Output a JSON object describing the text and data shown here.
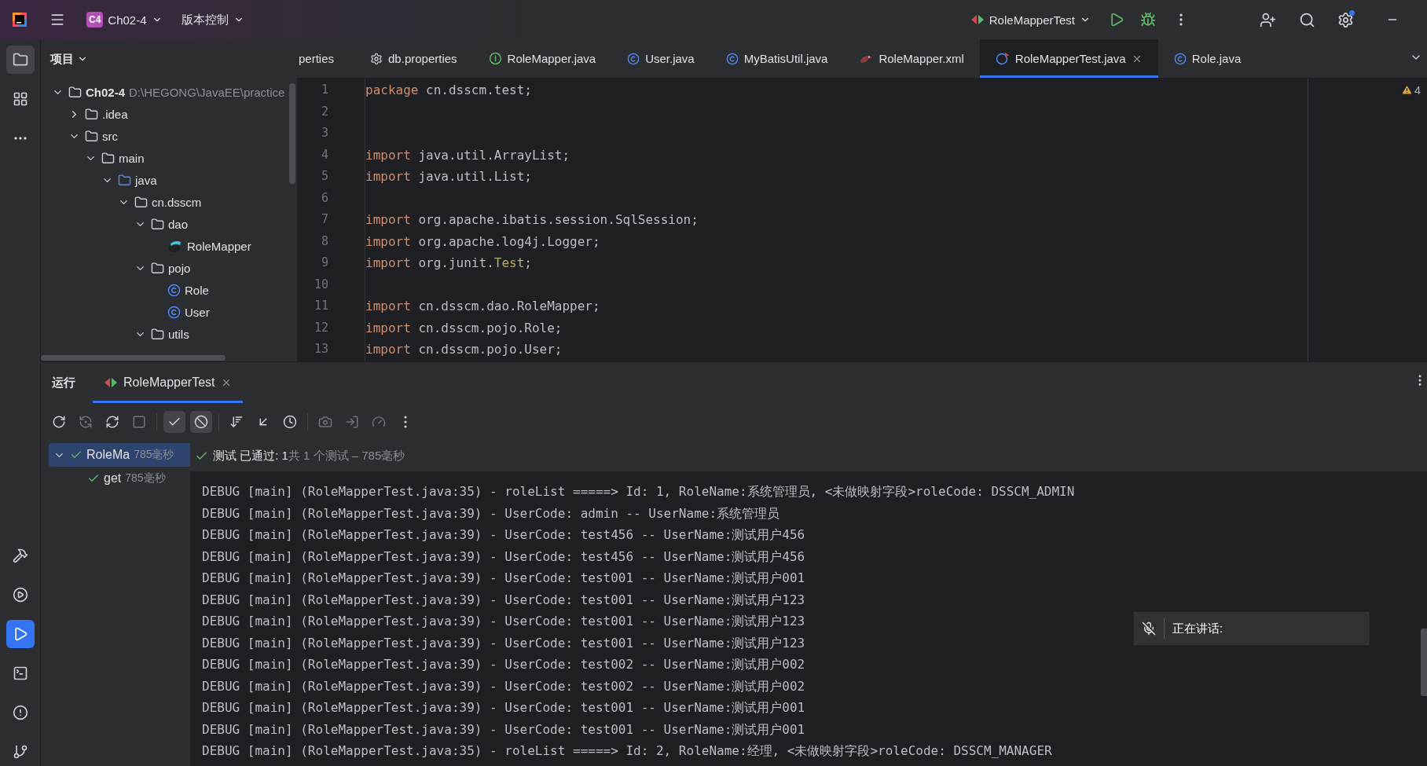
{
  "title_bar": {
    "project_badge": "C4",
    "project": "Ch02-4",
    "vcs": "版本控制",
    "run_config": "RoleMapperTest"
  },
  "left_toolbar": {
    "top": [
      {
        "kind": "project",
        "selected": true
      },
      {
        "kind": "structure",
        "selected": false
      },
      {
        "kind": "more",
        "selected": false
      }
    ],
    "bottom": [
      {
        "kind": "build",
        "selected": false
      },
      {
        "kind": "services",
        "selected": false
      },
      {
        "kind": "run",
        "selected": true
      },
      {
        "kind": "terminal",
        "selected": false
      },
      {
        "kind": "problems",
        "selected": false
      },
      {
        "kind": "git",
        "selected": false
      }
    ]
  },
  "project_panel": {
    "title": "项目",
    "tree": [
      {
        "label": "Ch02-4",
        "path": "D:\\HEGONG\\JavaEE\\practice",
        "kind": "module",
        "expanded": true,
        "children": [
          {
            "label": ".idea",
            "kind": "folder",
            "expanded": false
          },
          {
            "label": "src",
            "kind": "folder",
            "expanded": true,
            "children": [
              {
                "label": "main",
                "kind": "folder",
                "expanded": true,
                "children": [
                  {
                    "label": "java",
                    "kind": "source",
                    "expanded": true,
                    "children": [
                      {
                        "label": "cn.dsscm",
                        "kind": "package",
                        "expanded": true,
                        "children": [
                          {
                            "label": "dao",
                            "kind": "package",
                            "expanded": true,
                            "children": [
                              {
                                "label": "RoleMapper",
                                "kind": "mapper"
                              }
                            ]
                          },
                          {
                            "label": "pojo",
                            "kind": "package",
                            "expanded": true,
                            "children": [
                              {
                                "label": "Role",
                                "kind": "class"
                              },
                              {
                                "label": "User",
                                "kind": "class"
                              }
                            ]
                          },
                          {
                            "label": "utils",
                            "kind": "package",
                            "expanded": true
                          }
                        ]
                      }
                    ]
                  }
                ]
              }
            ]
          }
        ]
      }
    ]
  },
  "editor_tabs": [
    {
      "label": "perties",
      "kind": "none",
      "selected": false
    },
    {
      "label": "db.properties",
      "kind": "properties",
      "selected": false
    },
    {
      "label": "RoleMapper.java",
      "kind": "interface",
      "selected": false
    },
    {
      "label": "User.java",
      "kind": "class",
      "selected": false
    },
    {
      "label": "MyBatisUtil.java",
      "kind": "class",
      "selected": false
    },
    {
      "label": "RoleMapper.xml",
      "kind": "xml",
      "selected": false
    },
    {
      "label": "RoleMapperTest.java",
      "kind": "test",
      "selected": true
    },
    {
      "label": "Role.java",
      "kind": "class",
      "selected": false
    }
  ],
  "editor": {
    "warnings": "4",
    "lines": [
      {
        "number": "1",
        "tokens": [
          {
            "text": "package",
            "kind": "keyword"
          },
          {
            "text": " cn.dsscm.test;",
            "kind": "plain"
          }
        ]
      },
      {
        "number": "2"
      },
      {
        "number": "3"
      },
      {
        "number": "4",
        "tokens": [
          {
            "text": "import",
            "kind": "keyword"
          },
          {
            "text": " java.util.ArrayList;",
            "kind": "plain"
          }
        ]
      },
      {
        "number": "5",
        "tokens": [
          {
            "text": "import",
            "kind": "keyword"
          },
          {
            "text": " java.util.List;",
            "kind": "plain"
          }
        ]
      },
      {
        "number": "6"
      },
      {
        "number": "7",
        "tokens": [
          {
            "text": "import",
            "kind": "keyword"
          },
          {
            "text": " org.apache.ibatis.session.SqlSession;",
            "kind": "plain"
          }
        ]
      },
      {
        "number": "8",
        "tokens": [
          {
            "text": "import",
            "kind": "keyword"
          },
          {
            "text": " org.apache.log4j.Logger;",
            "kind": "plain"
          }
        ]
      },
      {
        "number": "9",
        "tokens": [
          {
            "text": "import",
            "kind": "keyword"
          },
          {
            "text": " org.junit.",
            "kind": "plain"
          },
          {
            "text": "Test",
            "kind": "annotation"
          },
          {
            "text": ";",
            "kind": "plain"
          }
        ]
      },
      {
        "number": "10"
      },
      {
        "number": "11",
        "tokens": [
          {
            "text": "import",
            "kind": "keyword"
          },
          {
            "text": " cn.dsscm.dao.RoleMapper;",
            "kind": "plain"
          }
        ]
      },
      {
        "number": "12",
        "tokens": [
          {
            "text": "import",
            "kind": "keyword"
          },
          {
            "text": " cn.dsscm.pojo.Role;",
            "kind": "plain"
          }
        ]
      },
      {
        "number": "13",
        "tokens": [
          {
            "text": "import",
            "kind": "keyword"
          },
          {
            "text": " cn.dsscm.pojo.User;",
            "kind": "plain"
          }
        ]
      }
    ]
  },
  "run_panel": {
    "title": "运行",
    "tabs": [
      {
        "label": "RoleMapperTest",
        "selected": true
      }
    ],
    "toolbar": [
      {
        "kind": "rerun",
        "disabled": false,
        "selected": false
      },
      {
        "kind": "rerun-failed",
        "disabled": true,
        "selected": false
      },
      {
        "kind": "auto-test",
        "disabled": false,
        "selected": false
      },
      {
        "kind": "stop",
        "disabled": true,
        "selected": false
      },
      {
        "kind": "passed",
        "disabled": false,
        "selected": true
      },
      {
        "kind": "ignored",
        "disabled": false,
        "selected": true
      },
      {
        "kind": "sort",
        "disabled": false,
        "selected": false
      },
      {
        "kind": "collapse",
        "disabled": false,
        "selected": false
      },
      {
        "kind": "history",
        "disabled": false,
        "selected": false
      },
      {
        "kind": "snapshot",
        "disabled": true,
        "selected": false
      },
      {
        "kind": "import",
        "disabled": true,
        "selected": false
      },
      {
        "kind": "profile",
        "disabled": true,
        "selected": false
      },
      {
        "kind": "more",
        "disabled": false,
        "selected": false
      }
    ],
    "test_tree": [
      {
        "label": "RoleMa",
        "time": "785毫秒",
        "passed": true,
        "selected": true,
        "expanded": true,
        "children": [
          {
            "label": "get",
            "time": "785毫秒",
            "passed": true,
            "selected": false
          }
        ]
      }
    ],
    "status": "测试 已通过: 1",
    "summary": "共 1 个测试 – 785毫秒",
    "console": [
      "DEBUG [main] (RoleMapperTest.java:35) - roleList =====> Id: 1, RoleName:系统管理员, <未做映射字段>roleCode: DSSCM_ADMIN",
      "DEBUG [main] (RoleMapperTest.java:39) - UserCode: admin -- UserName:系统管理员",
      "DEBUG [main] (RoleMapperTest.java:39) - UserCode: test456 -- UserName:测试用户456",
      "DEBUG [main] (RoleMapperTest.java:39) - UserCode: test456 -- UserName:测试用户456",
      "DEBUG [main] (RoleMapperTest.java:39) - UserCode: test001 -- UserName:测试用户001",
      "DEBUG [main] (RoleMapperTest.java:39) - UserCode: test001 -- UserName:测试用户123",
      "DEBUG [main] (RoleMapperTest.java:39) - UserCode: test001 -- UserName:测试用户123",
      "DEBUG [main] (RoleMapperTest.java:39) - UserCode: test001 -- UserName:测试用户123",
      "DEBUG [main] (RoleMapperTest.java:39) - UserCode: test002 -- UserName:测试用户002",
      "DEBUG [main] (RoleMapperTest.java:39) - UserCode: test002 -- UserName:测试用户002",
      "DEBUG [main] (RoleMapperTest.java:39) - UserCode: test001 -- UserName:测试用户001",
      "DEBUG [main] (RoleMapperTest.java:39) - UserCode: test001 -- UserName:测试用户001",
      "DEBUG [main] (RoleMapperTest.java:35) - roleList =====> Id: 2, RoleName:经理, <未做映射字段>roleCode: DSSCM_MANAGER"
    ]
  },
  "voice_overlay": {
    "label": "正在讲话:",
    "muted": true
  }
}
